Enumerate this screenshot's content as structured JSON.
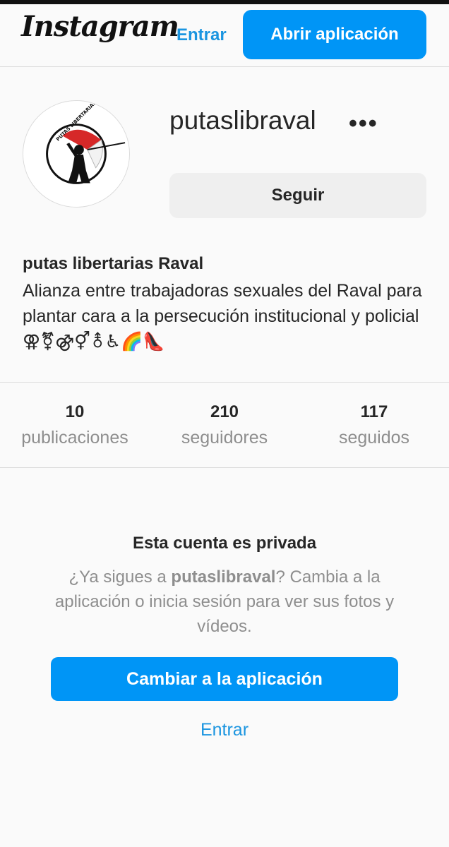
{
  "header": {
    "logo": "Instagram",
    "login_label": "Entrar",
    "open_app_label": "Abrir aplicación"
  },
  "profile": {
    "username": "putaslibraval",
    "more_label": "•••",
    "follow_label": "Seguir",
    "full_name": "putas libertarias Raval",
    "bio": "Alianza entre trabajadoras sexuales del Raval para plantar cara a la persecución institucional y policial ⚢⚧⚣⚥⚨♿🌈👠",
    "avatar_logo_text": "PUTAS LIBERTARIAS RAVAL"
  },
  "stats": [
    {
      "value": "10",
      "label": "publicaciones"
    },
    {
      "value": "210",
      "label": "seguidores"
    },
    {
      "value": "117",
      "label": "seguidos"
    }
  ],
  "private": {
    "title": "Esta cuenta es privada",
    "text_pre": "¿Ya sigues a ",
    "text_user": "putaslibraval",
    "text_post": "? Cambia a la aplicación o inicia sesión para ver sus fotos y vídeos.",
    "switch_label": "Cambiar a la aplicación",
    "login_label": "Entrar"
  },
  "colors": {
    "accent": "#0095f6",
    "link": "#1b95e0",
    "muted": "#8e8e8e"
  },
  "icons": [
    "more-icon",
    "avatar-logo"
  ]
}
